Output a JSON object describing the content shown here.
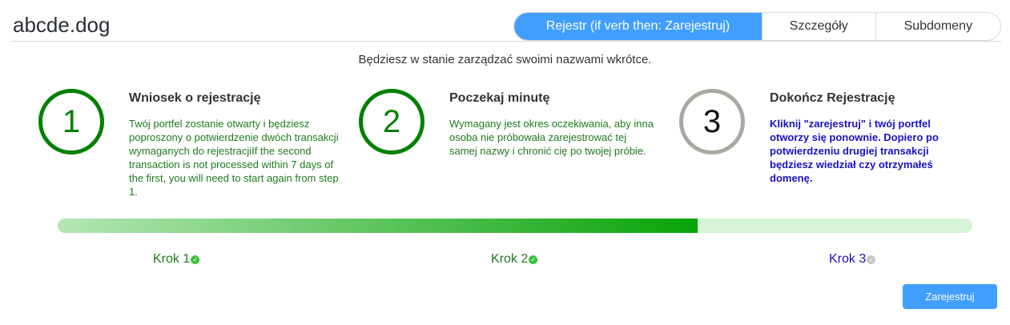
{
  "header": {
    "title": "abcde.dog",
    "tabs": [
      {
        "label": "Rejestr (if verb then: Zarejestruj)",
        "active": true
      },
      {
        "label": "Szczegóły",
        "active": false
      },
      {
        "label": "Subdomeny",
        "active": false
      }
    ]
  },
  "subtitle": "Będziesz w stanie zarządzać swoimi nazwami wkrótce.",
  "steps": [
    {
      "number": "1",
      "title": "Wniosek o rejestrację",
      "description": "Twój portfel zostanie otwarty i będziesz poproszony o potwierdzenie dwóch transakcji wymaganych do rejestracjiIf the second transaction is not processed within 7 days of the first, you will need to start again from step 1.",
      "status": "done"
    },
    {
      "number": "2",
      "title": "Poczekaj minutę",
      "description": "Wymagany jest okres oczekiwania, aby inna osoba nie próbowała zarejestrować tej samej nazwy i chronić cię po twojej próbie.",
      "status": "done"
    },
    {
      "number": "3",
      "title": "Dokończ Rejestrację",
      "description": "Kliknij \"zarejestruj\" i twój portfel otworzy się ponownie. Dopiero po potwierdzeniu drugiej transakcji będziesz wiedział czy otrzymałeś domenę.",
      "status": "pending"
    }
  ],
  "progress": {
    "fraction": 0.7
  },
  "krok_labels": [
    {
      "label": "Krok 1",
      "status": "done",
      "icon": "check-circle-icon"
    },
    {
      "label": "Krok 2",
      "status": "done",
      "icon": "check-circle-icon"
    },
    {
      "label": "Krok 3",
      "status": "pending",
      "icon": "check-circle-icon"
    }
  ],
  "colors": {
    "accent": "#409eff",
    "done_green": "#008000",
    "pending_gray": "#a8a8a0",
    "pending_text": "#1a10c8"
  },
  "actions": {
    "register_label": "Zarejestruj"
  }
}
